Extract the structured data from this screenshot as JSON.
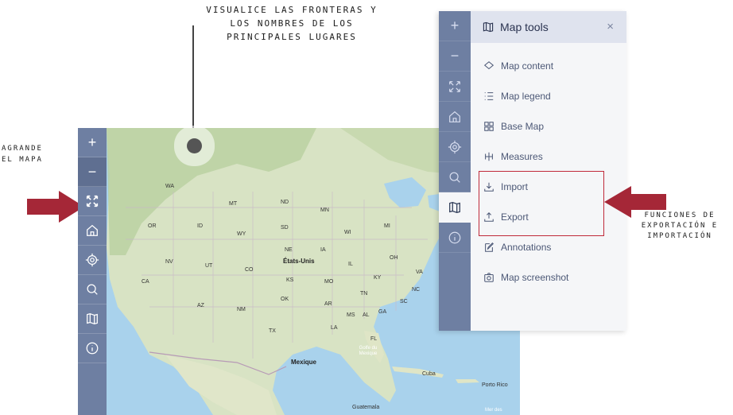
{
  "annotations": {
    "top": "Visualice las fronteras y los nombres de los principales lugares",
    "left": "Agrande el mapa",
    "right": "Funciones de exportación e importación"
  },
  "map": {
    "labels": {
      "usa": "États-Unis",
      "mexico": "Mexique",
      "gulf": "Golfe du Mexique",
      "cuba": "Cuba",
      "puerto_rico": "Porto Rico",
      "guatemala": "Guatemala",
      "sea": "Mer des"
    },
    "state_labels": [
      "WA",
      "MT",
      "ND",
      "MN",
      "OR",
      "ID",
      "WY",
      "SD",
      "WI",
      "MI",
      "NV",
      "UT",
      "CO",
      "NE",
      "IA",
      "IL",
      "OH",
      "CA",
      "AZ",
      "NM",
      "KS",
      "MO",
      "KY",
      "VA",
      "OK",
      "AR",
      "TN",
      "NC",
      "TX",
      "LA",
      "MS",
      "AL",
      "GA",
      "SC",
      "FL"
    ],
    "colors": {
      "water": "#a9d2ec",
      "land": "#d8e3c4",
      "toolbar": "#6e7fa2"
    }
  },
  "toolbar": {
    "zoom_in": "+",
    "zoom_out": "−",
    "icons": [
      "fullscreen-icon",
      "home-icon",
      "locate-icon",
      "search-icon",
      "map-icon",
      "info-icon"
    ]
  },
  "panel": {
    "title": "Map tools",
    "close": "×",
    "items": [
      {
        "label": "Map content",
        "icon": "layers-icon"
      },
      {
        "label": "Map legend",
        "icon": "legend-icon"
      },
      {
        "label": "Base Map",
        "icon": "grid-icon"
      },
      {
        "label": "Measures",
        "icon": "measure-icon"
      },
      {
        "label": "Import",
        "icon": "import-icon"
      },
      {
        "label": "Export",
        "icon": "export-icon"
      },
      {
        "label": "Annotations",
        "icon": "edit-icon"
      },
      {
        "label": "Map screenshot",
        "icon": "camera-icon"
      }
    ]
  },
  "accent_color": "#a52737"
}
